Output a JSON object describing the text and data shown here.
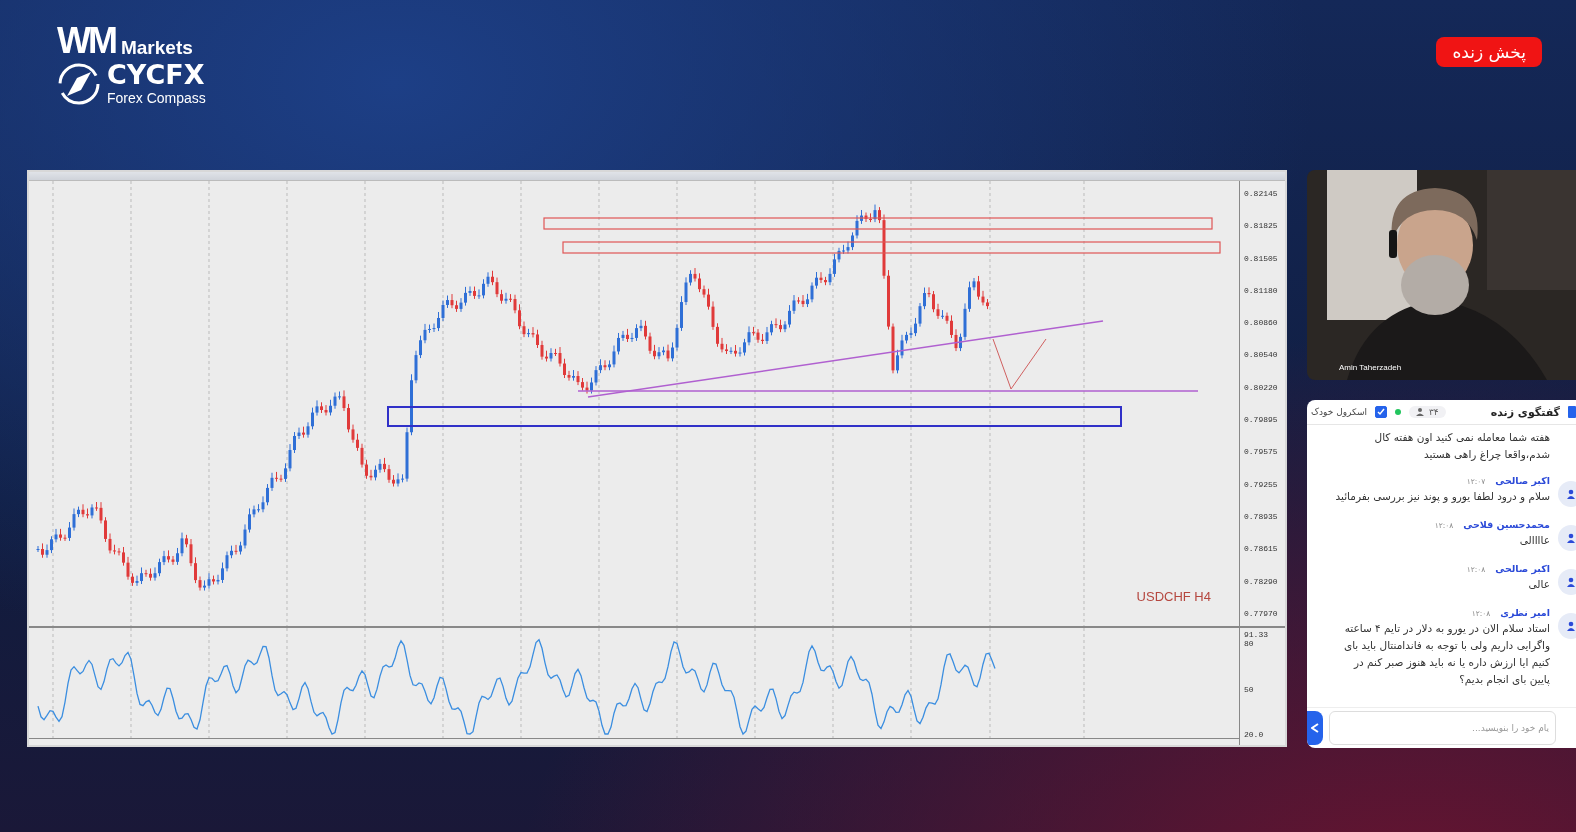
{
  "logo": {
    "mark": "WM",
    "brand": "Markets",
    "name": "CYCFX",
    "tagline": "Forex Compass"
  },
  "live_badge": {
    "label": "پخش زنده"
  },
  "chart": {
    "symbol": "USDCHF H4",
    "price_labels": [
      "0.82145",
      "0.81825",
      "0.81505",
      "0.81180",
      "0.80860",
      "0.80540",
      "0.80220",
      "0.79895",
      "0.79575",
      "0.79255",
      "0.78935",
      "0.78615",
      "0.78290",
      "0.77970"
    ],
    "rsi_labels": [
      "91.33",
      "80",
      "50",
      "20.0"
    ]
  },
  "webcam": {
    "kind": "picture",
    "name": "Amin Taherzadeh"
  },
  "chat": {
    "title": "گفتگوی زنده",
    "viewers": "۳۴",
    "auto_scroll": {
      "label": "اسکرول خودک",
      "checked": true
    },
    "messages": [
      {
        "text": "هفته شما معامله نمی کنید اون هفته کال شدم،واقعا چراغ راهی هستید"
      },
      {
        "author": "اکبر صالحی",
        "time": "۱۲:۰۷",
        "text": "سلام و درود لطفا یورو و پوند نیز بررسی بفرمائید"
      },
      {
        "author": "محمدحسین فلاحی",
        "time": "۱۲:۰۸",
        "text": "عاااالی"
      },
      {
        "author": "اکبر صالحی",
        "time": "۱۲:۰۸",
        "text": "عالی"
      },
      {
        "author": "امیر نظری",
        "time": "۱۲:۰۸",
        "text": "استاد سلام الان در یورو به دلار در تایم ۴ ساعته واگرایی داریم ولی با توجه به فاندامنتال باید بای کنیم ایا ارزش داره یا نه باید هنوز صبر کنم در پایین بای انجام بدیم؟"
      }
    ],
    "input": {
      "placeholder": "یام خود را بنویسید..."
    }
  }
}
